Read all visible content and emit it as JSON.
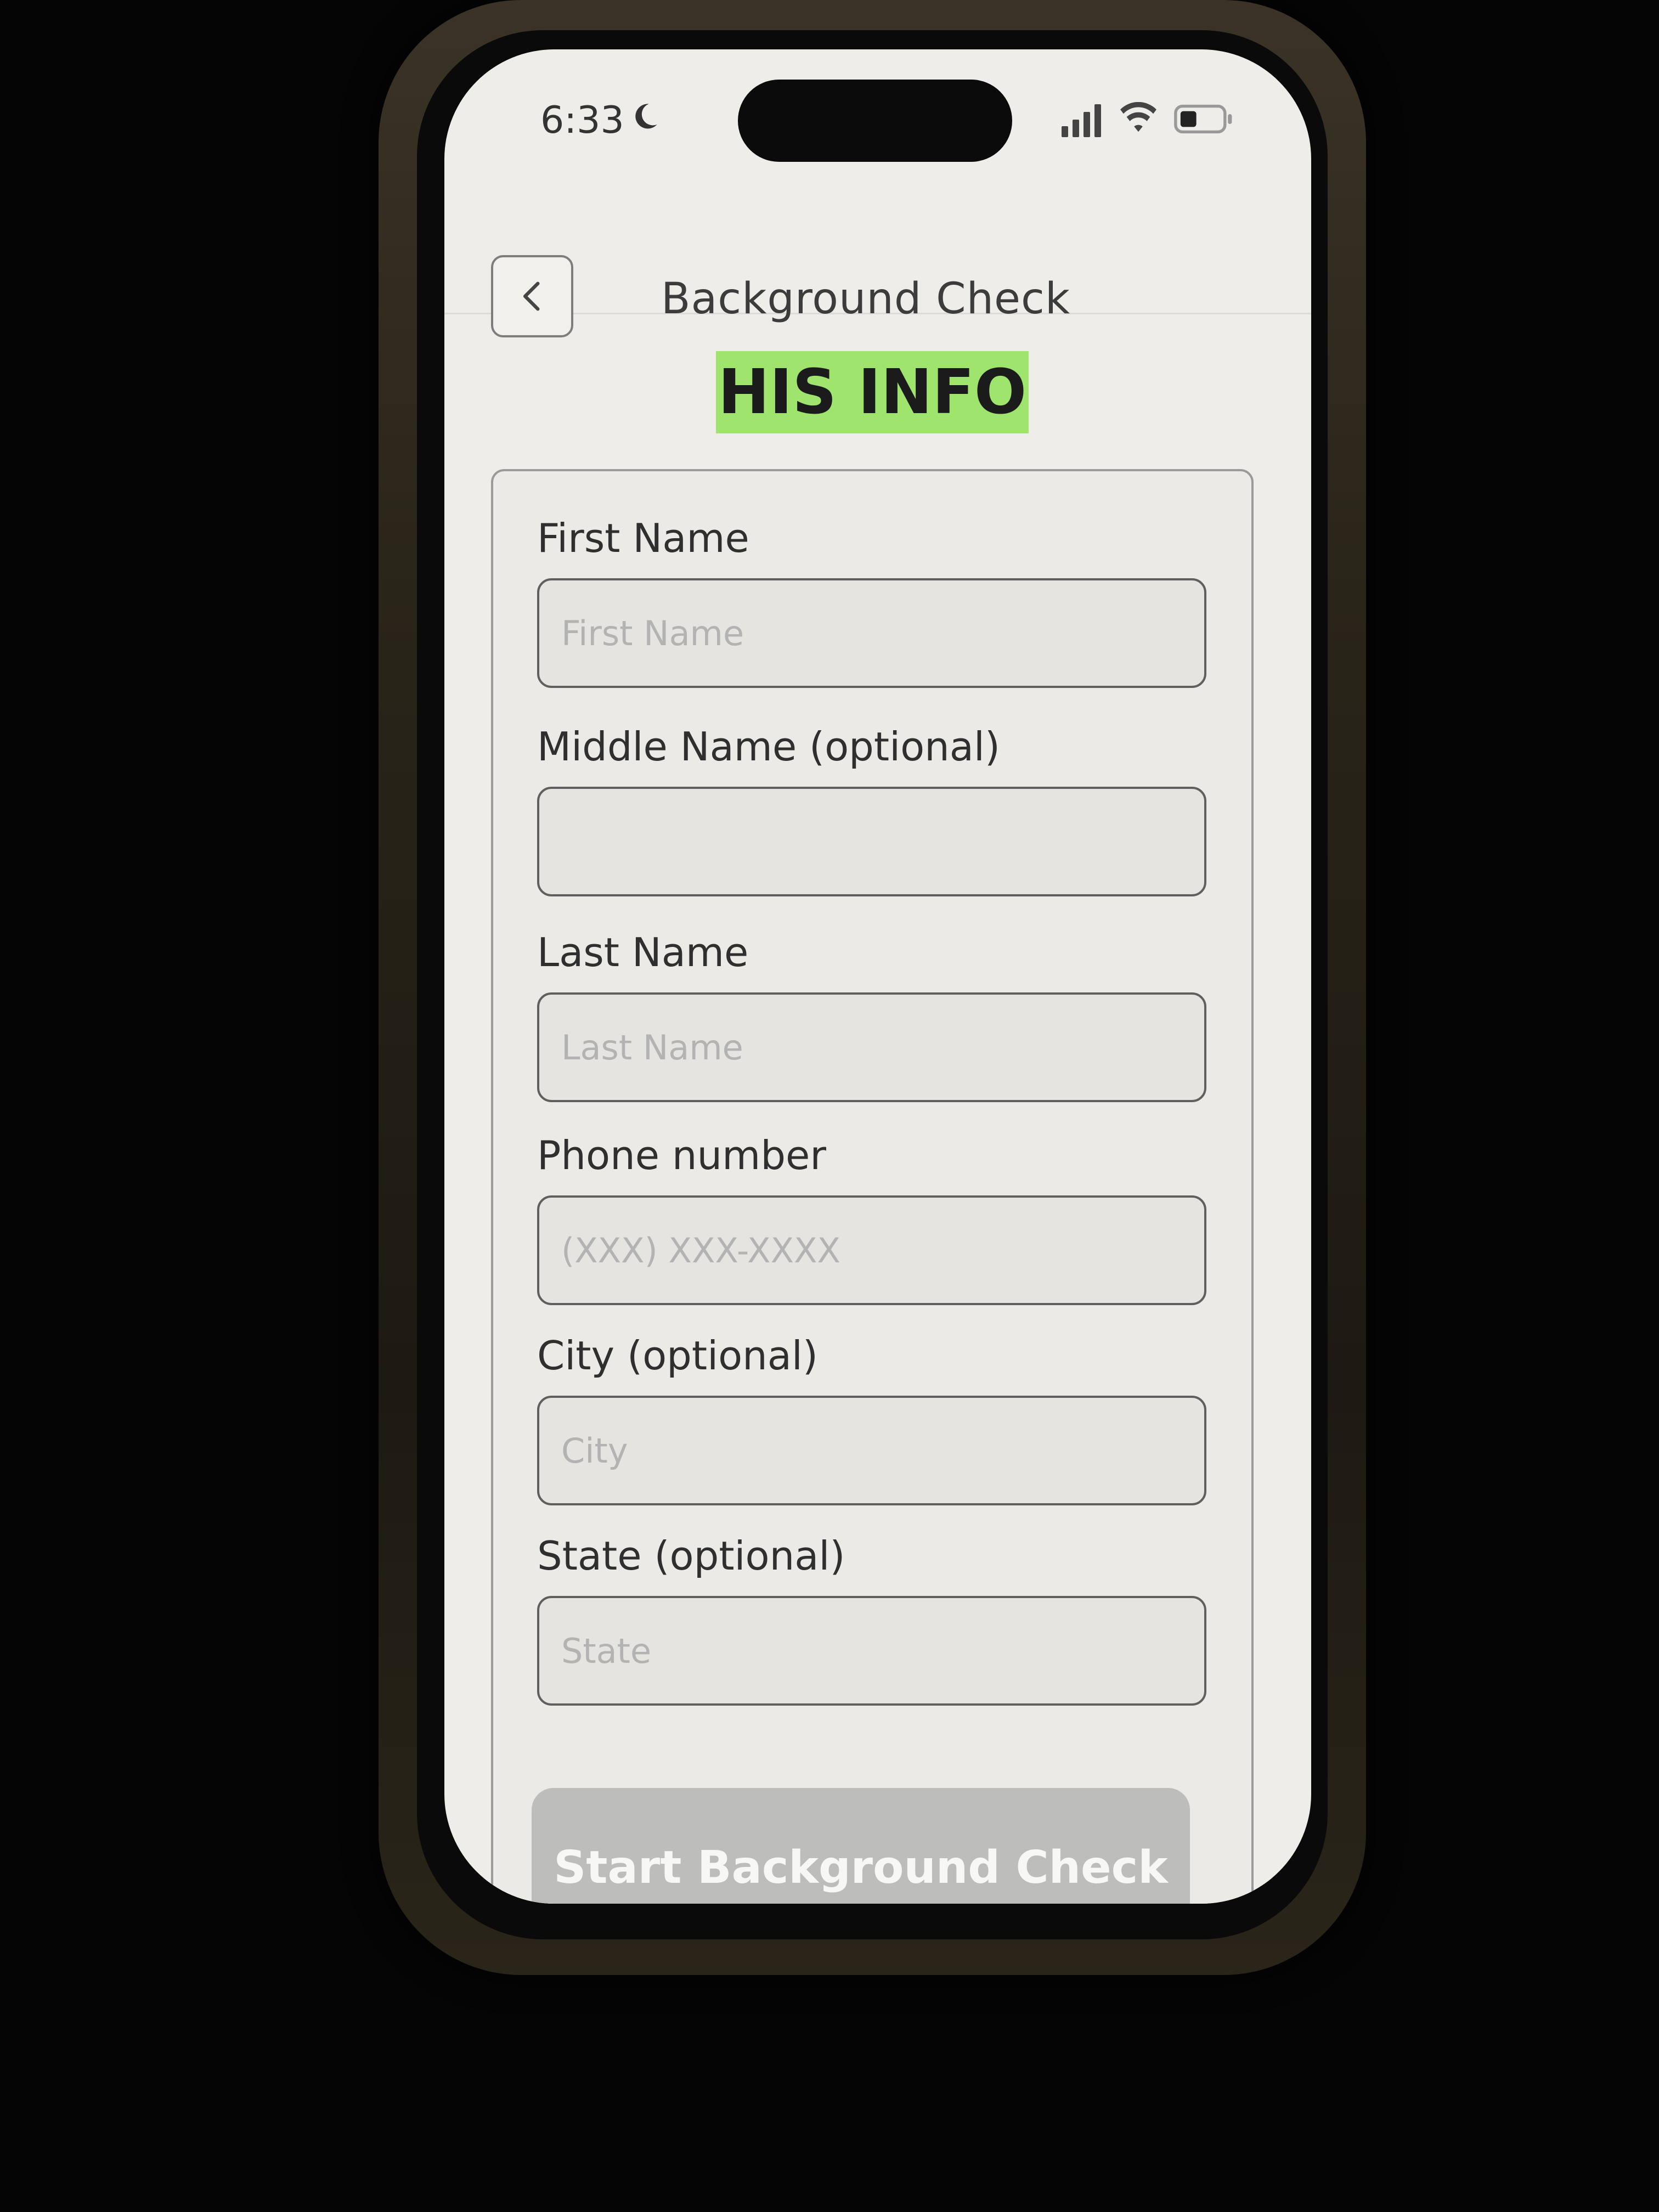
{
  "status_bar": {
    "time": "6:33",
    "icons": [
      "moon-icon",
      "signal-icon",
      "wifi-icon",
      "battery-icon"
    ]
  },
  "header": {
    "back_icon": "chevron-left-icon",
    "title": "Background Check"
  },
  "section": {
    "label": "HIS INFO",
    "highlight_color": "#9fe46d"
  },
  "form": {
    "fields": [
      {
        "label": "First Name",
        "placeholder": "First Name",
        "value": ""
      },
      {
        "label": "Middle Name (optional)",
        "placeholder": "",
        "value": ""
      },
      {
        "label": "Last Name",
        "placeholder": "Last Name",
        "value": ""
      },
      {
        "label": "Phone number",
        "placeholder": "(XXX) XXX-XXXX",
        "value": ""
      },
      {
        "label": "City (optional)",
        "placeholder": "City",
        "value": ""
      },
      {
        "label": "State (optional)",
        "placeholder": "State",
        "value": ""
      }
    ],
    "submit_label": "Start Background Check",
    "submit_state": "disabled"
  }
}
